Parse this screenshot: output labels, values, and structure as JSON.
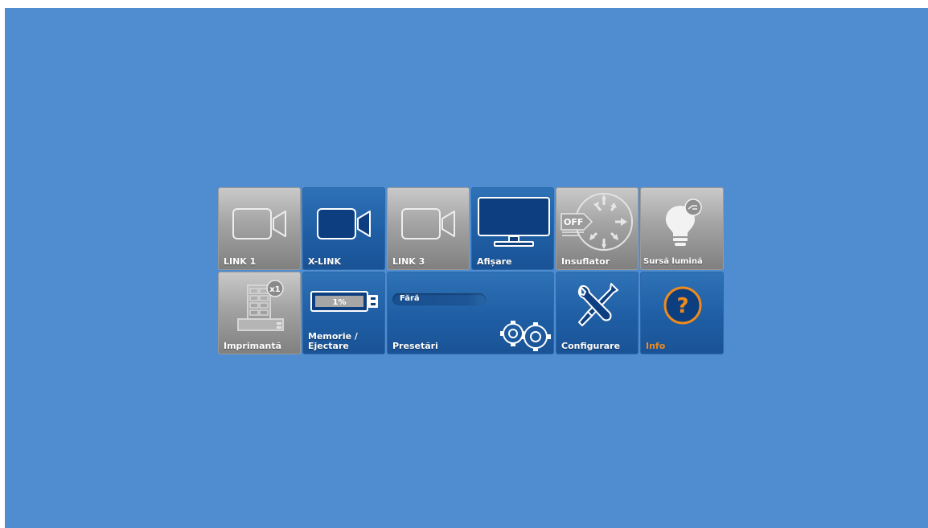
{
  "tiles": {
    "link1": {
      "label": "LINK 1",
      "icon": "camera-icon"
    },
    "xlink": {
      "label": "X-LINK",
      "icon": "camera-icon"
    },
    "link3": {
      "label": "LINK 3",
      "icon": "camera-icon"
    },
    "afisare": {
      "label": "Afișare",
      "icon": "monitor-icon"
    },
    "insuflator": {
      "label": "Insuflator",
      "icon": "insufflator-icon",
      "status": "OFF"
    },
    "sursa_lumina": {
      "label": "Sursă lumină",
      "icon": "light-bulb-icon"
    },
    "imprimanta": {
      "label": "Imprimantă",
      "icon": "printer-icon",
      "count": "x1"
    },
    "memorie": {
      "label_line1": "Memorie /",
      "label_line2": "Ejectare",
      "icon": "usb-drive-icon",
      "usage": "1%"
    },
    "presetari": {
      "label": "Presetări",
      "icon": "gears-icon",
      "current": "Fără"
    },
    "configurare": {
      "label": "Configurare",
      "icon": "tools-icon"
    },
    "info": {
      "label": "Info",
      "icon": "help-icon",
      "symbol": "?"
    }
  },
  "colors": {
    "background": "#4f8dd0",
    "tile_blue": "#1f5ea4",
    "tile_gray": "#a3a3a3",
    "accent_orange": "#f08a1c"
  }
}
